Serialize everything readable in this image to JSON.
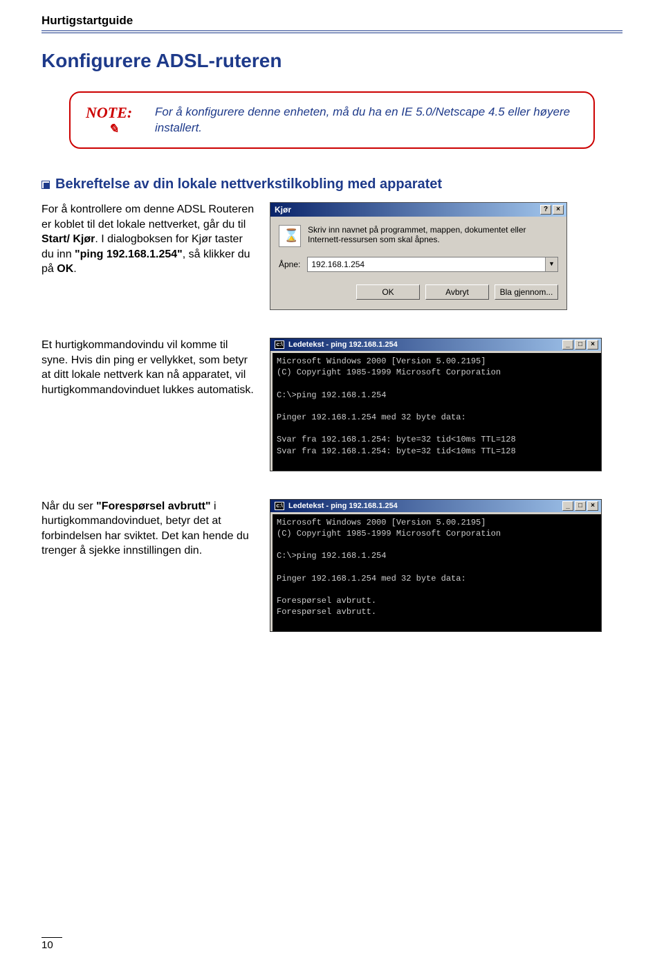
{
  "doc": {
    "header": "Hurtigstartguide",
    "page_number": "10"
  },
  "section": {
    "title": "Konfigurere  ADSL-ruteren"
  },
  "note": {
    "label": "NOTE:",
    "text": "For å konfigurere denne enheten, må du ha en IE 5.0/Netscape 4.5 eller høyere installert."
  },
  "subheader": "Bekreftelse av din lokale nettverkstilkobling med apparatet",
  "para1": {
    "t1": "For å kontrollere om denne ADSL Routeren er koblet til det lokale nettverket,  går du til ",
    "b1": "Start/ Kjør",
    "t2": ".  I dialogboksen for Kjør taster du inn ",
    "b2": "\"ping 192.168.1.254\"",
    "t3": ", så klikker du på ",
    "b3": "OK",
    "t4": "."
  },
  "run_dialog": {
    "title": "Kjør",
    "help_btn": "?",
    "close_btn": "×",
    "desc": "Skriv inn navnet på programmet, mappen, dokumentet eller Internett-ressursen som skal åpnes.",
    "open_label": "Åpne:",
    "input_value": "192.168.1.254",
    "buttons": {
      "ok": "OK",
      "cancel": "Avbryt",
      "browse": "Bla gjennom..."
    }
  },
  "para2": "Et hurtigkommandovindu vil komme til syne.  Hvis din ping er vellykket,  som betyr at ditt lokale nettverk kan nå apparatet,  vil hurtigkommandovinduet lukkes automatisk.",
  "cmd1": {
    "title": "Ledetekst - ping 192.168.1.254",
    "body": "Microsoft Windows 2000 [Version 5.00.2195]\n(C) Copyright 1985-1999 Microsoft Corporation\n\nC:\\>ping 192.168.1.254\n\nPinger 192.168.1.254 med 32 byte data:\n\nSvar fra 192.168.1.254: byte=32 tid<10ms TTL=128\nSvar fra 192.168.1.254: byte=32 tid<10ms TTL=128"
  },
  "para3": {
    "t1": "Når du ser ",
    "b1": "\"Forespørsel avbrutt\"",
    "t2": " i hurtigkommandovinduet,  betyr det at forbindelsen har sviktet.   Det kan hende du trenger å sjekke innstillingen din."
  },
  "cmd2": {
    "title": "Ledetekst - ping 192.168.1.254",
    "body": "Microsoft Windows 2000 [Version 5.00.2195]\n(C) Copyright 1985-1999 Microsoft Corporation\n\nC:\\>ping 192.168.1.254\n\nPinger 192.168.1.254 med 32 byte data:\n\nForespørsel avbrutt.\nForespørsel avbrutt."
  }
}
